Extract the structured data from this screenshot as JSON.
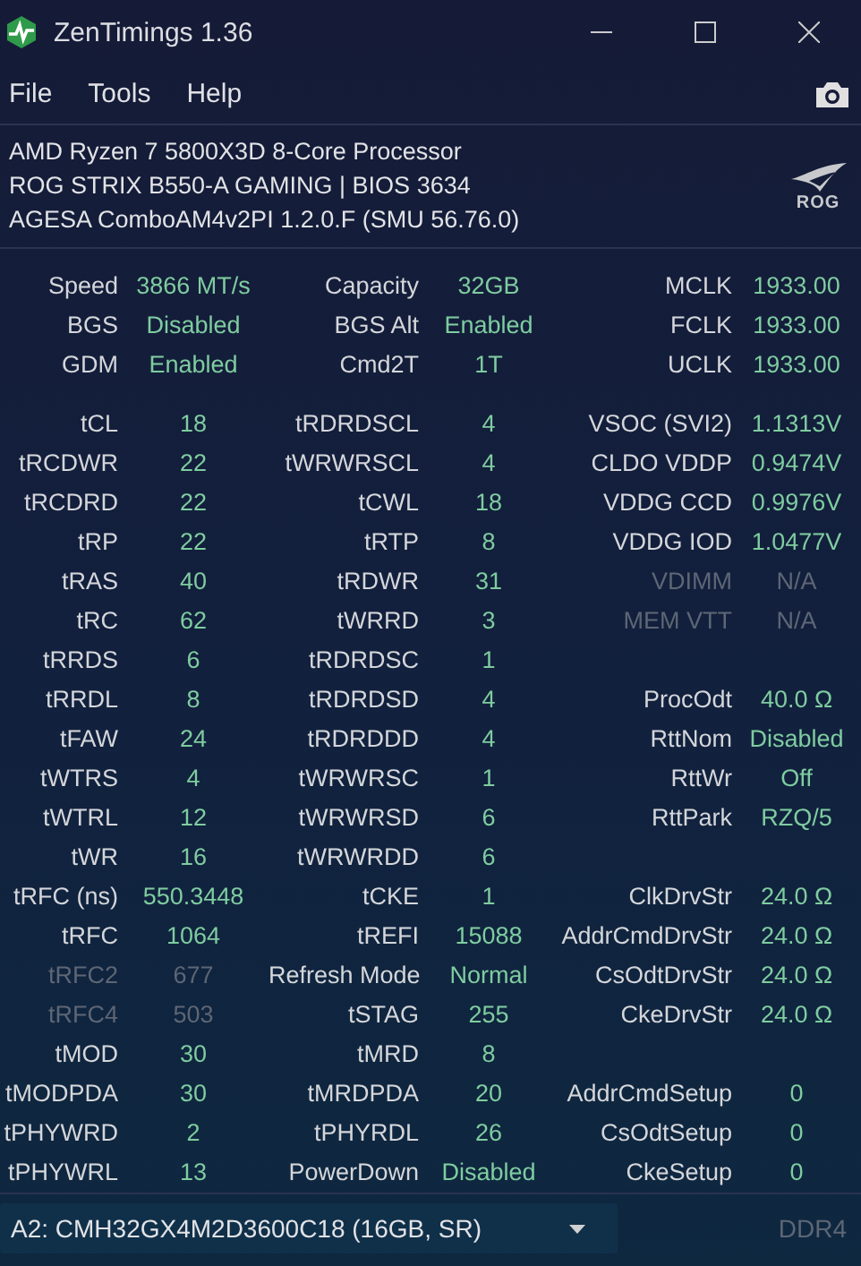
{
  "window": {
    "title": "ZenTimings 1.36"
  },
  "menu": [
    "File",
    "Tools",
    "Help"
  ],
  "system_info": {
    "lines": [
      "AMD Ryzen 7 5800X3D 8-Core Processor",
      "ROG STRIX B550-A GAMING | BIOS 3634",
      "AGESA ComboAM4v2PI 1.2.0.F (SMU 56.76.0)"
    ],
    "logo_text": "ROG"
  },
  "summary": [
    {
      "left": {
        "label": "Speed",
        "value": "3866 MT/s",
        "disabled": false
      },
      "middle": {
        "label": "Capacity",
        "value": "32GB",
        "disabled": false
      },
      "right": {
        "label": "MCLK",
        "value": "1933.00",
        "disabled": false
      }
    },
    {
      "left": {
        "label": "BGS",
        "value": "Disabled",
        "disabled": false
      },
      "middle": {
        "label": "BGS Alt",
        "value": "Enabled",
        "disabled": false
      },
      "right": {
        "label": "FCLK",
        "value": "1933.00",
        "disabled": false
      }
    },
    {
      "left": {
        "label": "GDM",
        "value": "Enabled",
        "disabled": false
      },
      "middle": {
        "label": "Cmd2T",
        "value": "1T",
        "disabled": false
      },
      "right": {
        "label": "UCLK",
        "value": "1933.00",
        "disabled": false
      }
    }
  ],
  "timings": [
    {
      "left": {
        "label": "tCL",
        "value": "18",
        "disabled": false
      },
      "middle": {
        "label": "tRDRDSCL",
        "value": "4",
        "disabled": false
      },
      "right": {
        "label": "VSOC (SVI2)",
        "value": "1.1313V",
        "disabled": false
      }
    },
    {
      "left": {
        "label": "tRCDWR",
        "value": "22",
        "disabled": false
      },
      "middle": {
        "label": "tWRWRSCL",
        "value": "4",
        "disabled": false
      },
      "right": {
        "label": "CLDO VDDP",
        "value": "0.9474V",
        "disabled": false
      }
    },
    {
      "left": {
        "label": "tRCDRD",
        "value": "22",
        "disabled": false
      },
      "middle": {
        "label": "tCWL",
        "value": "18",
        "disabled": false
      },
      "right": {
        "label": "VDDG CCD",
        "value": "0.9976V",
        "disabled": false
      }
    },
    {
      "left": {
        "label": "tRP",
        "value": "22",
        "disabled": false
      },
      "middle": {
        "label": "tRTP",
        "value": "8",
        "disabled": false
      },
      "right": {
        "label": "VDDG IOD",
        "value": "1.0477V",
        "disabled": false
      }
    },
    {
      "left": {
        "label": "tRAS",
        "value": "40",
        "disabled": false
      },
      "middle": {
        "label": "tRDWR",
        "value": "31",
        "disabled": false
      },
      "right": {
        "label": "VDIMM",
        "value": "N/A",
        "disabled": true
      }
    },
    {
      "left": {
        "label": "tRC",
        "value": "62",
        "disabled": false
      },
      "middle": {
        "label": "tWRRD",
        "value": "3",
        "disabled": false
      },
      "right": {
        "label": "MEM VTT",
        "value": "N/A",
        "disabled": true
      }
    },
    {
      "left": {
        "label": "tRRDS",
        "value": "6",
        "disabled": false
      },
      "middle": {
        "label": "tRDRDSC",
        "value": "1",
        "disabled": false
      }
    },
    {
      "left": {
        "label": "tRRDL",
        "value": "8",
        "disabled": false
      },
      "middle": {
        "label": "tRDRDSD",
        "value": "4",
        "disabled": false
      },
      "right": {
        "label": "ProcOdt",
        "value": "40.0 Ω",
        "disabled": false
      }
    },
    {
      "left": {
        "label": "tFAW",
        "value": "24",
        "disabled": false
      },
      "middle": {
        "label": "tRDRDDD",
        "value": "4",
        "disabled": false
      },
      "right": {
        "label": "RttNom",
        "value": "Disabled",
        "disabled": false
      }
    },
    {
      "left": {
        "label": "tWTRS",
        "value": "4",
        "disabled": false
      },
      "middle": {
        "label": "tWRWRSC",
        "value": "1",
        "disabled": false
      },
      "right": {
        "label": "RttWr",
        "value": "Off",
        "disabled": false
      }
    },
    {
      "left": {
        "label": "tWTRL",
        "value": "12",
        "disabled": false
      },
      "middle": {
        "label": "tWRWRSD",
        "value": "6",
        "disabled": false
      },
      "right": {
        "label": "RttPark",
        "value": "RZQ/5",
        "disabled": false
      }
    },
    {
      "left": {
        "label": "tWR",
        "value": "16",
        "disabled": false
      },
      "middle": {
        "label": "tWRWRDD",
        "value": "6",
        "disabled": false
      }
    },
    {
      "left": {
        "label": "tRFC (ns)",
        "value": "550.3448",
        "disabled": false
      },
      "middle": {
        "label": "tCKE",
        "value": "1",
        "disabled": false
      },
      "right": {
        "label": "ClkDrvStr",
        "value": "24.0 Ω",
        "disabled": false
      }
    },
    {
      "left": {
        "label": "tRFC",
        "value": "1064",
        "disabled": false
      },
      "middle": {
        "label": "tREFI",
        "value": "15088",
        "disabled": false
      },
      "right": {
        "label": "AddrCmdDrvStr",
        "value": "24.0 Ω",
        "disabled": false
      }
    },
    {
      "left": {
        "label": "tRFC2",
        "value": "677",
        "disabled": true
      },
      "middle": {
        "label": "Refresh Mode",
        "value": "Normal",
        "disabled": false
      },
      "right": {
        "label": "CsOdtDrvStr",
        "value": "24.0 Ω",
        "disabled": false
      }
    },
    {
      "left": {
        "label": "tRFC4",
        "value": "503",
        "disabled": true
      },
      "middle": {
        "label": "tSTAG",
        "value": "255",
        "disabled": false
      },
      "right": {
        "label": "CkeDrvStr",
        "value": "24.0 Ω",
        "disabled": false
      }
    },
    {
      "left": {
        "label": "tMOD",
        "value": "30",
        "disabled": false
      },
      "middle": {
        "label": "tMRD",
        "value": "8",
        "disabled": false
      }
    },
    {
      "left": {
        "label": "tMODPDA",
        "value": "30",
        "disabled": false
      },
      "middle": {
        "label": "tMRDPDA",
        "value": "20",
        "disabled": false
      },
      "right": {
        "label": "AddrCmdSetup",
        "value": "0",
        "disabled": false
      }
    },
    {
      "left": {
        "label": "tPHYWRD",
        "value": "2",
        "disabled": false
      },
      "middle": {
        "label": "tPHYRDL",
        "value": "26",
        "disabled": false
      },
      "right": {
        "label": "CsOdtSetup",
        "value": "0",
        "disabled": false
      }
    },
    {
      "left": {
        "label": "tPHYWRL",
        "value": "13",
        "disabled": false
      },
      "middle": {
        "label": "PowerDown",
        "value": "Disabled",
        "disabled": false
      },
      "right": {
        "label": "CkeSetup",
        "value": "0",
        "disabled": false
      }
    }
  ],
  "footer": {
    "module_select": {
      "value": "A2: CMH32GX4M2D3600C18 (16GB, SR)"
    },
    "memory_type": "DDR4"
  }
}
